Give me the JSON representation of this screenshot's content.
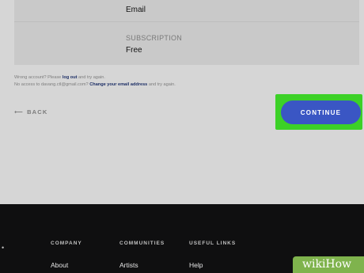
{
  "account": {
    "email_label": "Email",
    "subscription_label": "SUBSCRIPTION",
    "subscription_value": "Free"
  },
  "messages": {
    "wrong_account_pre": "Wrong account? Please ",
    "log_out": "log out",
    "wrong_account_post": " and try again.",
    "no_access_pre": "No access to davang.ctl@gmail.com? ",
    "change_email": "Change your email address",
    "no_access_post": " and try again."
  },
  "nav": {
    "back_arrow": "⟵",
    "back_label": "BACK",
    "continue_label": "CONTINUE"
  },
  "footer": {
    "columns": [
      {
        "heading": "COMPANY",
        "items": [
          "About"
        ]
      },
      {
        "heading": "COMMUNITIES",
        "items": [
          "Artists"
        ]
      },
      {
        "heading": "USEFUL LINKS",
        "items": [
          "Help"
        ]
      }
    ]
  },
  "watermark": {
    "text": "wikiHow"
  },
  "colors": {
    "highlight": "#3cd127",
    "button": "#3a56c4",
    "footer": "#0f0f10",
    "watermark": "#7fb34d"
  }
}
